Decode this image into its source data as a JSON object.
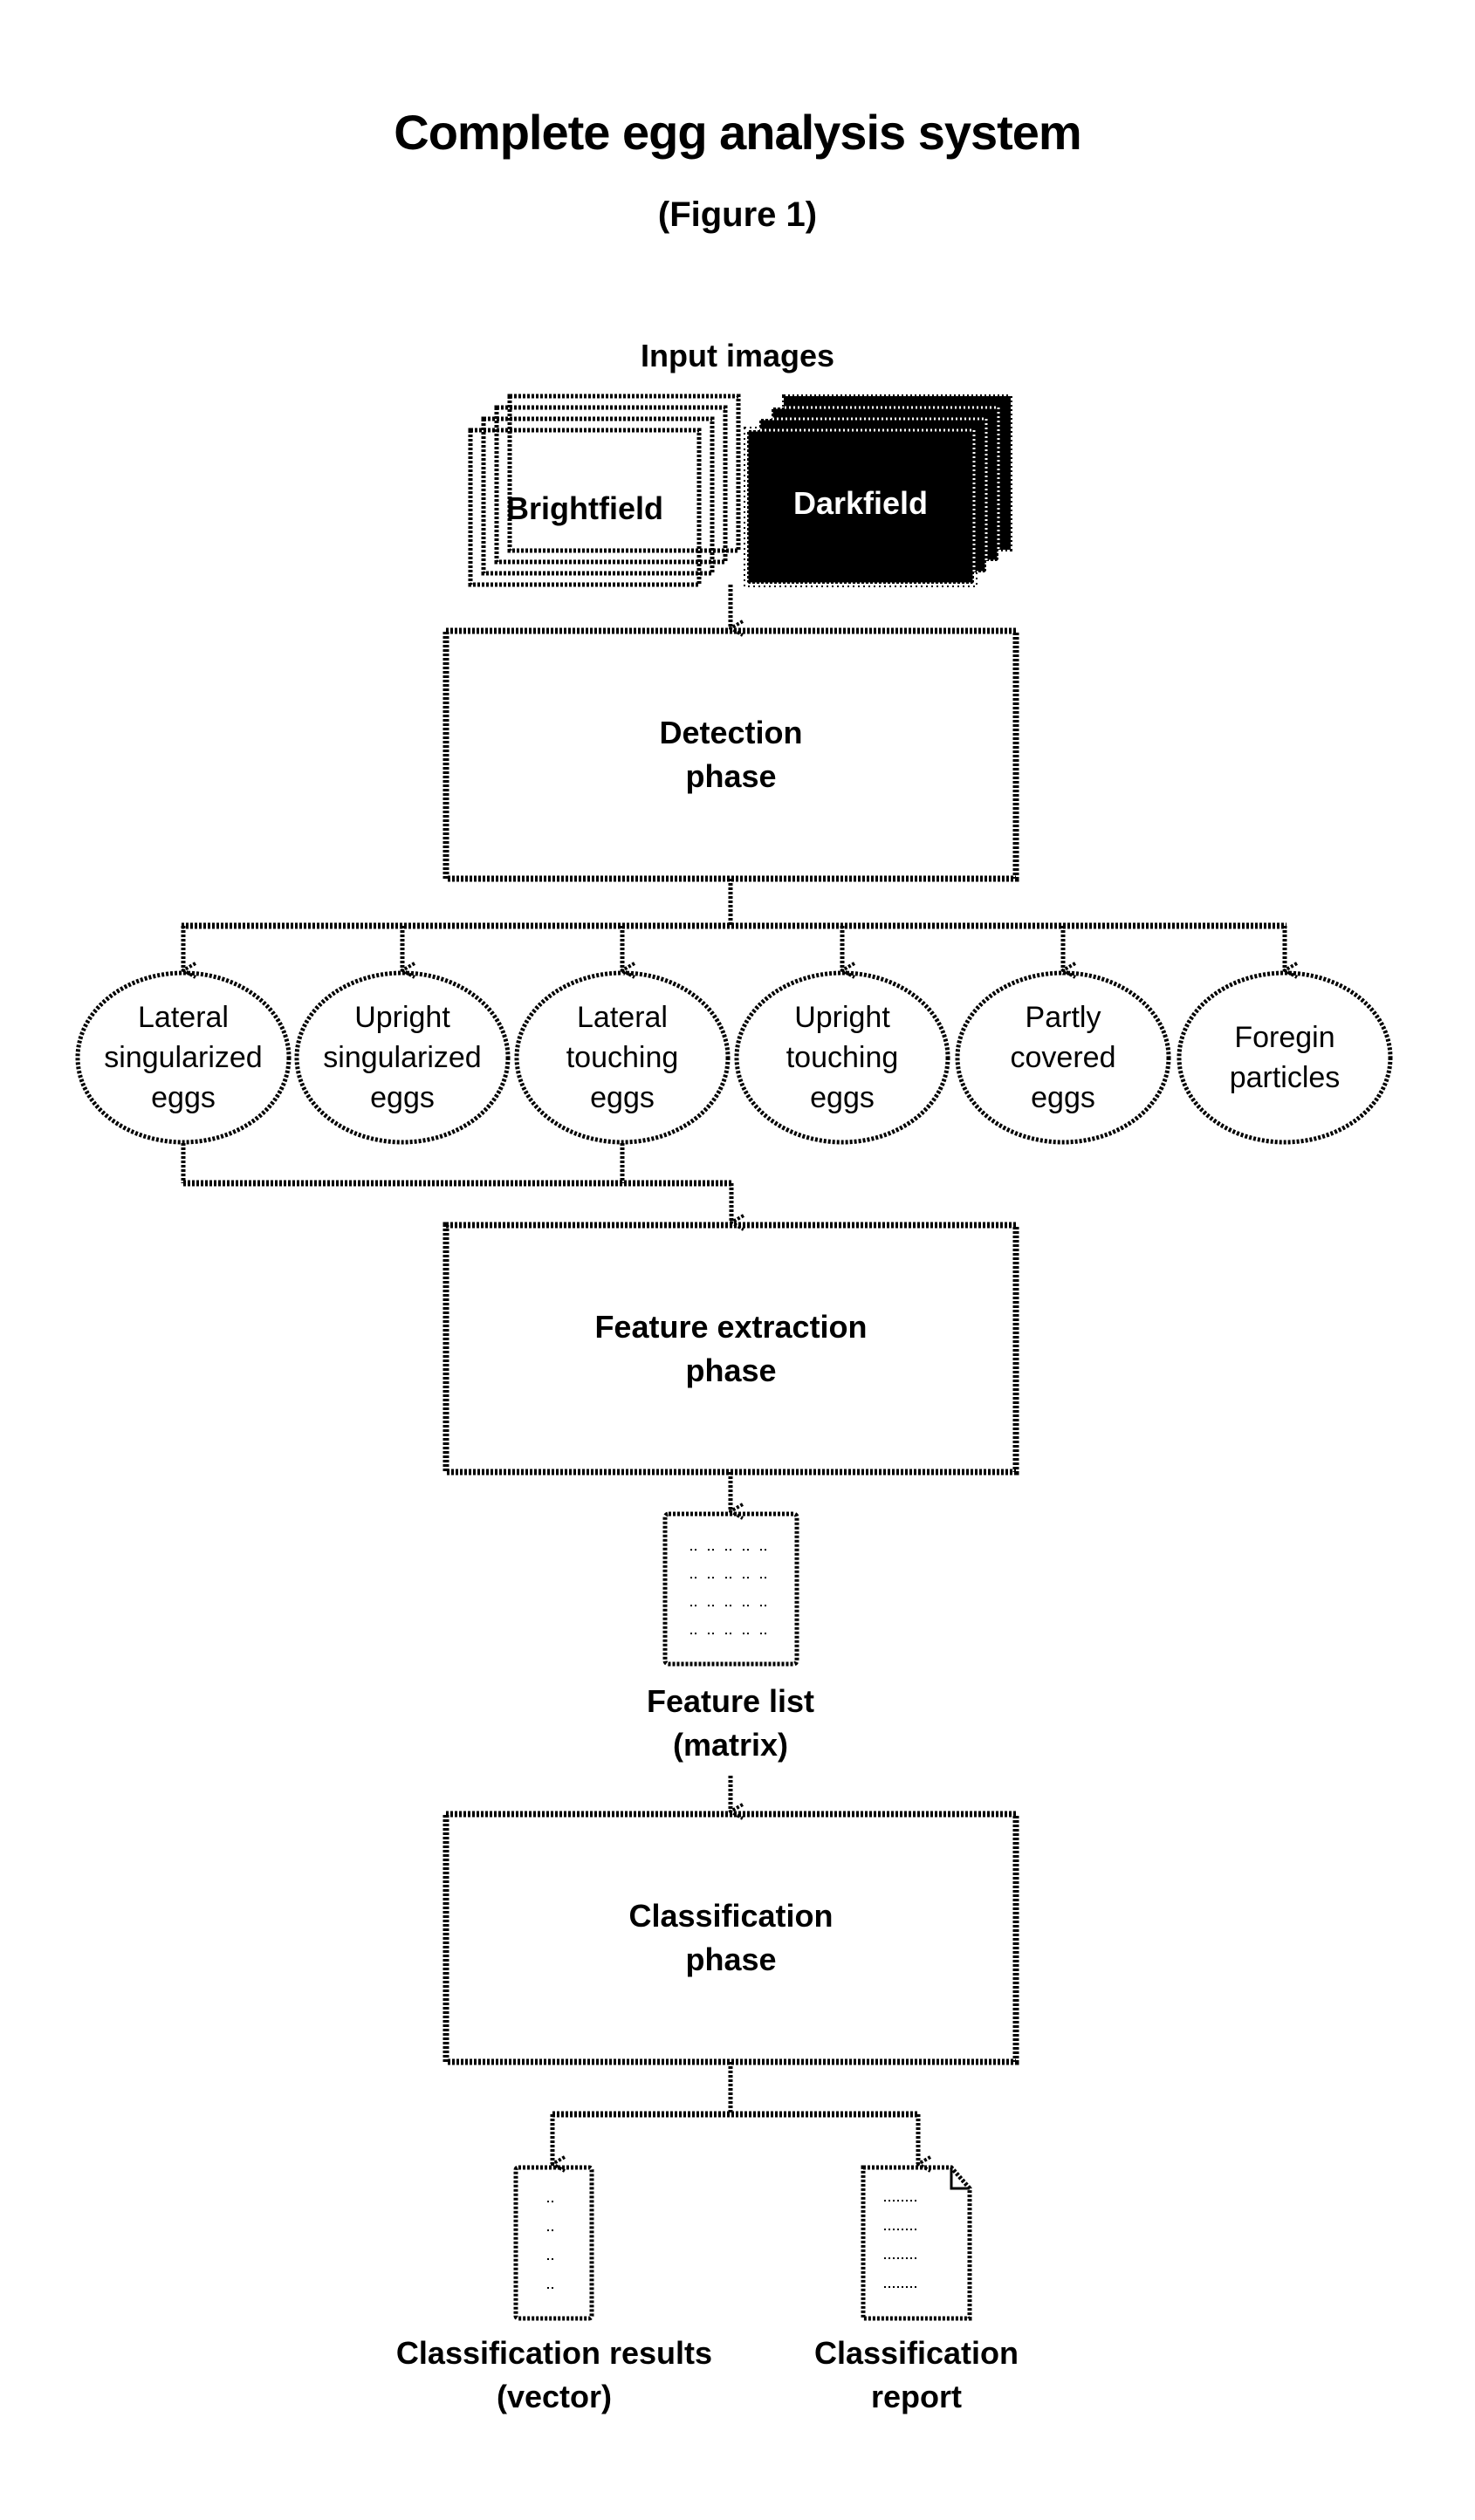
{
  "header": {
    "title": "Complete egg analysis system",
    "subtitle": "(Figure 1)"
  },
  "input_images": {
    "label": "Input images",
    "brightfield": "Brightfield",
    "darkfield": "Darkfield"
  },
  "phases": {
    "detection": [
      "Detection",
      "phase"
    ],
    "feature_extraction": [
      "Feature extraction",
      "phase"
    ],
    "classification": [
      "Classification",
      "phase"
    ]
  },
  "egg_categories": [
    {
      "lines": [
        "Lateral",
        "singularized",
        "eggs"
      ]
    },
    {
      "lines": [
        "Upright",
        "singularized",
        "eggs"
      ]
    },
    {
      "lines": [
        "Lateral",
        "touching",
        "eggs"
      ]
    },
    {
      "lines": [
        "Upright",
        "touching",
        "eggs"
      ]
    },
    {
      "lines": [
        "Partly",
        "covered",
        "eggs"
      ]
    },
    {
      "lines": [
        "Foregin",
        "particles"
      ]
    }
  ],
  "feature_list": {
    "label_line1": "Feature list",
    "label_line2": "(matrix)",
    "icon": "document-matrix-icon"
  },
  "outputs": {
    "results": {
      "line1": "Classification results",
      "line2": "(vector)",
      "icon": "document-vector-icon"
    },
    "report": {
      "line1": "Classification",
      "line2": "report",
      "icon": "document-report-icon"
    }
  },
  "colors": {
    "ink": "#000000",
    "background": "#ffffff",
    "phase_fill": "#c9c9c9",
    "darkfield_fill": "#000000"
  }
}
